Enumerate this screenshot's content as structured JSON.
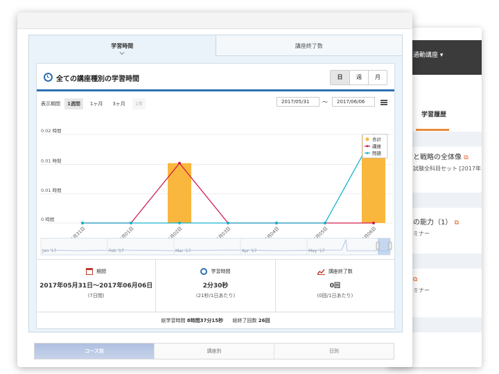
{
  "background_window": {
    "menu_label": "通動講座 ▾",
    "tab_label": "学習履歴",
    "item1_title": "と戦略の全体像",
    "item1_sub": "試験全科目セット [2017年",
    "item2_title": "の能力（1）",
    "item2_sub": "ミナー",
    "item3_sub": "ミナー"
  },
  "top_tabs": [
    {
      "label": "学習時間",
      "active": true
    },
    {
      "label": "講座終了数",
      "active": false
    }
  ],
  "card": {
    "title": "全ての講座種別の学習時間",
    "granularity": [
      "日",
      "週",
      "月"
    ],
    "selected_granularity": "日"
  },
  "period": {
    "label": "表示期間",
    "options": [
      "1週間",
      "1ヶ月",
      "3ヶ月",
      "1年"
    ],
    "selected": "1週間",
    "disabled": "1年",
    "start": "2017/05/31",
    "end": "2017/06/06",
    "separator": "～"
  },
  "chart_data": {
    "type": "line",
    "categories": [
      "05月31日",
      "06月01日",
      "06月02日",
      "06月03日",
      "06月04日",
      "06月05日",
      "06月06日"
    ],
    "y_tick_labels": [
      "0.02 時間",
      "0.01 時間",
      "0.01 時間",
      "0 時間"
    ],
    "ylim": [
      0,
      0.02
    ],
    "series": [
      {
        "name": "合計",
        "kind": "bar",
        "color": "#f9b73d",
        "values": [
          0,
          0,
          0.0135,
          0,
          0,
          0,
          0.0198
        ]
      },
      {
        "name": "講座",
        "kind": "line",
        "color": "#d01c4e",
        "values": [
          0,
          0,
          0.0135,
          0,
          0,
          0,
          0
        ]
      },
      {
        "name": "問題",
        "kind": "line",
        "color": "#18b3d0",
        "values": [
          0,
          0,
          0,
          0,
          0,
          0,
          0.0198
        ]
      }
    ],
    "legend_position": "top-right",
    "navigator_labels": [
      "Jan '17",
      "Feb '17",
      "Mar '17",
      "Apr '17",
      "May '17"
    ]
  },
  "stats": {
    "period_label": "期間",
    "period_value": "2017年05月31日～2017年06月06日",
    "period_sub": "(7日間)",
    "time_label": "学習時間",
    "time_value": "2分30秒",
    "time_sub": "(21秒/1日あたり)",
    "done_label": "講座終了数",
    "done_value": "0回",
    "done_sub": "(0回/1日あたり)"
  },
  "totals": {
    "total_time_label": "総学習時間",
    "total_time_value": "8時間37分15秒",
    "total_done_label": "総終了回数",
    "total_done_value": "26回"
  },
  "bottom_tabs": [
    "コース別",
    "講座別",
    "日別"
  ],
  "colors": {
    "accent": "#2c6fb3",
    "bar": "#f9b73d",
    "line_a": "#d01c4e",
    "line_b": "#18b3d0"
  }
}
